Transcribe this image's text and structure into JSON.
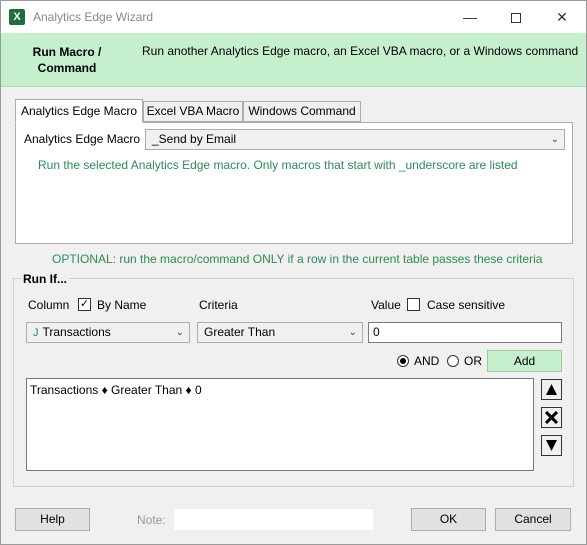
{
  "window": {
    "title": "Analytics Edge Wizard",
    "app_icon_letter": "X",
    "controls": {
      "minimize": "—",
      "close": "✕"
    }
  },
  "header": {
    "title": "Run Macro / Command",
    "description": "Run another Analytics Edge macro, an Excel VBA macro, or a Windows command",
    "background_color": "#c6efce"
  },
  "tabs": [
    {
      "label": "Analytics Edge Macro",
      "active": true
    },
    {
      "label": "Excel VBA Macro",
      "active": false
    },
    {
      "label": "Windows Command",
      "active": false
    }
  ],
  "macro_panel": {
    "label": "Analytics Edge Macro",
    "selected_macro": "_Send by Email",
    "hint": "Run the selected Analytics Edge macro. Only macros that start with _underscore are listed"
  },
  "optional_text": "OPTIONAL: run the macro/command ONLY if a row in the current table passes these criteria",
  "run_if": {
    "group_title": "Run If...",
    "column_label": "Column",
    "by_name_label": "By Name",
    "by_name_checked": true,
    "criteria_label": "Criteria",
    "value_label": "Value",
    "case_sensitive_label": "Case sensitive",
    "case_sensitive_checked": false,
    "column_value": "Transactions",
    "column_icon": "J",
    "criteria_value": "Greater Than",
    "value_input": "0",
    "and_label": "AND",
    "or_label": "OR",
    "logic_selected": "AND",
    "add_label": "Add",
    "criteria_lines": [
      "Transactions ♦ Greater Than ♦ 0"
    ]
  },
  "footer": {
    "help_label": "Help",
    "note_label": "Note:",
    "note_value": "",
    "ok_label": "OK",
    "cancel_label": "Cancel"
  },
  "accent_color": "#2e8b57"
}
